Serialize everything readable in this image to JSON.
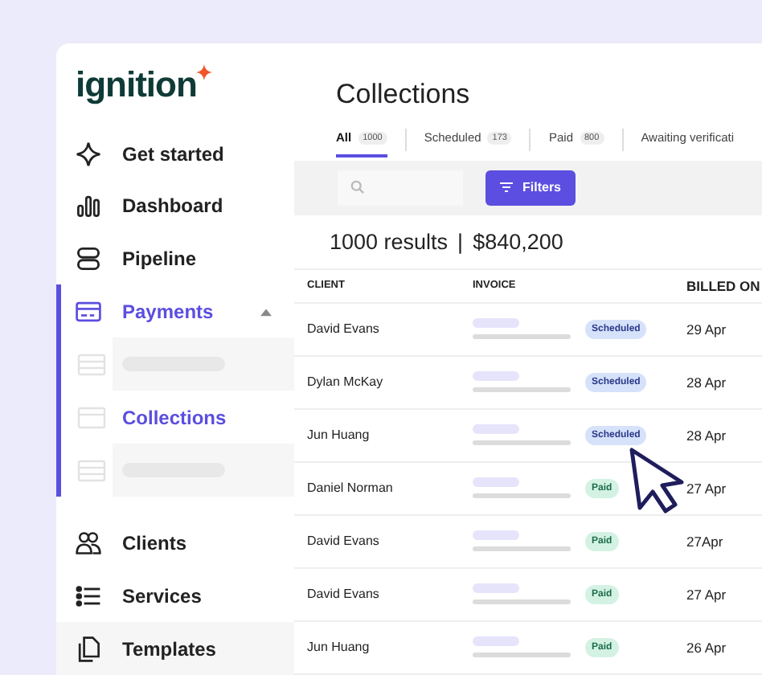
{
  "logo": {
    "text": "ignition"
  },
  "sidebar": {
    "items": [
      {
        "kind": "nav",
        "label": "Get started",
        "selected": false
      },
      {
        "kind": "nav",
        "label": "Dashboard",
        "selected": false
      },
      {
        "kind": "nav",
        "label": "Pipeline",
        "selected": false
      },
      {
        "kind": "group",
        "label": "Payments",
        "selected": true,
        "expanded": true,
        "children": [
          {
            "kind": "placeholder",
            "selected": false
          },
          {
            "kind": "nav",
            "label": "Collections",
            "selected": true
          },
          {
            "kind": "placeholder",
            "selected": false
          }
        ]
      },
      {
        "kind": "nav",
        "label": "Clients",
        "selected": false
      },
      {
        "kind": "nav",
        "label": "Services",
        "selected": false
      },
      {
        "kind": "nav",
        "label": "Templates",
        "selected": false
      }
    ]
  },
  "page": {
    "title": "Collections"
  },
  "tabs": [
    {
      "label": "All",
      "count": "1000",
      "selected": true
    },
    {
      "label": "Scheduled",
      "count": "173",
      "selected": false
    },
    {
      "label": "Paid",
      "count": "800",
      "selected": false
    },
    {
      "label": "Awaiting verificati",
      "selected": false
    }
  ],
  "toolbar": {
    "filters_button": "Filters"
  },
  "summary": {
    "results": "1000 results",
    "separator": "|",
    "total": "$840,200"
  },
  "table": {
    "columns": [
      "CLIENT",
      "INVOICE",
      "BILLED ON"
    ],
    "rows": [
      {
        "client": "David Evans",
        "status": {
          "kind": "scheduled",
          "label": "Scheduled"
        },
        "billed_on": "29 Apr"
      },
      {
        "client": "Dylan McKay",
        "status": {
          "kind": "scheduled",
          "label": "Scheduled"
        },
        "billed_on": "28 Apr"
      },
      {
        "client": "Jun Huang",
        "status": {
          "kind": "scheduled",
          "label": "Scheduled"
        },
        "billed_on": "28 Apr"
      },
      {
        "client": "Daniel Norman",
        "status": {
          "kind": "paid",
          "label": "Paid"
        },
        "billed_on": "27 Apr"
      },
      {
        "client": "David Evans",
        "status": {
          "kind": "paid",
          "label": "Paid"
        },
        "billed_on": "27Apr"
      },
      {
        "client": "David Evans",
        "status": {
          "kind": "paid",
          "label": "Paid"
        },
        "billed_on": "27 Apr"
      },
      {
        "client": "Jun Huang",
        "status": {
          "kind": "paid",
          "label": "Paid"
        },
        "billed_on": "26 Apr"
      }
    ]
  }
}
